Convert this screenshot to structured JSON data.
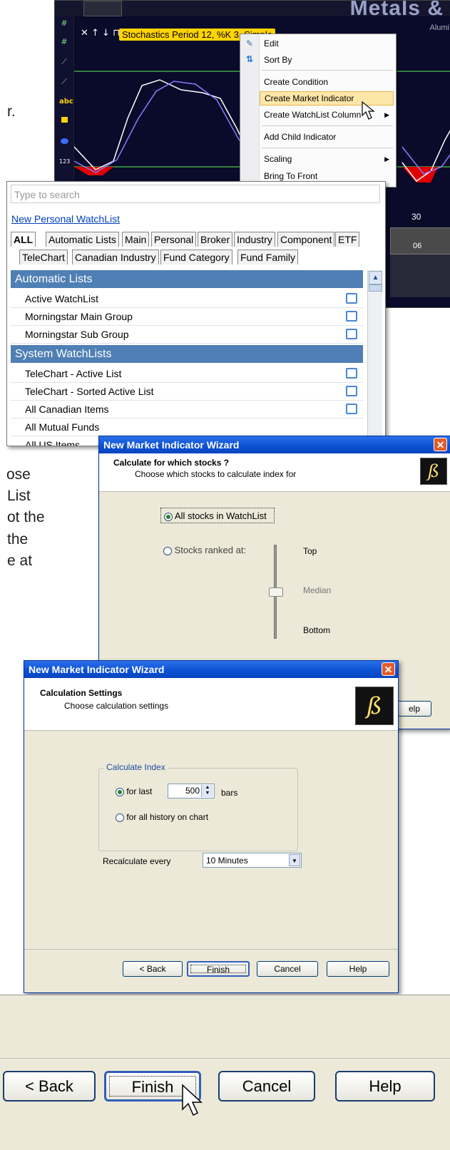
{
  "background_text": {
    "line1": "r.",
    "line2": "ose",
    "line3": "List",
    "line4": "ot the",
    "line5": "the",
    "line6": "e at"
  },
  "chart": {
    "title": "Metals &",
    "subtitle": "Alumi",
    "indicator_label": "Stochastics Period 12, %K 3, Simple",
    "controls": "✕ ↑ ↓ ⊓",
    "right_values": [
      "30",
      "06"
    ],
    "toolbar_icons": [
      "grid-icon",
      "grid-icon",
      "trendline-icon",
      "trendline-icon",
      "text-icon",
      "rectangle-icon",
      "ellipse-icon",
      "number-icon"
    ],
    "toolbar_text": [
      "abc",
      "123"
    ]
  },
  "context_menu": {
    "items": [
      {
        "label": "Edit"
      },
      {
        "label": "Sort By"
      },
      {
        "label": "Create Condition"
      },
      {
        "label": "Create Market Indicator"
      },
      {
        "label": "Create WatchList Column"
      },
      {
        "label": "Add Child Indicator"
      },
      {
        "label": "Scaling"
      },
      {
        "label": "Bring To Front"
      }
    ]
  },
  "watchlist": {
    "search_placeholder": "Type to search",
    "new_link": "New Personal WatchList",
    "tabs_row1": [
      "ALL",
      "Automatic Lists",
      "Main",
      "Personal",
      "Broker",
      "Industry",
      "Component",
      "ETF"
    ],
    "tabs_row2": [
      "TeleChart",
      "Canadian Industry",
      "Fund Category",
      "Fund Family"
    ],
    "section1": "Automatic Lists",
    "section1_items": [
      "Active WatchList",
      "Morningstar Main Group",
      "Morningstar Sub Group"
    ],
    "section2": "System WatchLists",
    "section2_items": [
      "TeleChart - Active List",
      "TeleChart - Sorted Active List",
      "All Canadian Items",
      "All Mutual Funds",
      "All US Items"
    ]
  },
  "wizard1": {
    "title": "New Market Indicator Wizard",
    "heading": "Calculate for which stocks ?",
    "subheading": "Choose which stocks to calculate index for",
    "option_all": "All stocks in WatchList",
    "option_ranked": "Stocks ranked at:",
    "slider_top": "Top",
    "slider_median": "Median",
    "slider_bottom": "Bottom",
    "help_partial": "elp"
  },
  "wizard2": {
    "title": "New Market Indicator Wizard",
    "heading": "Calculation Settings",
    "subheading": "Choose calculation settings",
    "group_title": "Calculate Index",
    "option_last": "for last",
    "bars_value": "500",
    "bars_label": "bars",
    "option_all_history": "for all history on chart",
    "recalc_label": "Recalculate every",
    "recalc_value": "10 Minutes",
    "btn_back": "< Back",
    "btn_finish": "Finish",
    "btn_cancel": "Cancel",
    "btn_help": "Help"
  },
  "bottom_strip": {
    "btn_back": "< Back",
    "btn_finish": "Finish",
    "btn_cancel": "Cancel",
    "btn_help": "Help"
  }
}
